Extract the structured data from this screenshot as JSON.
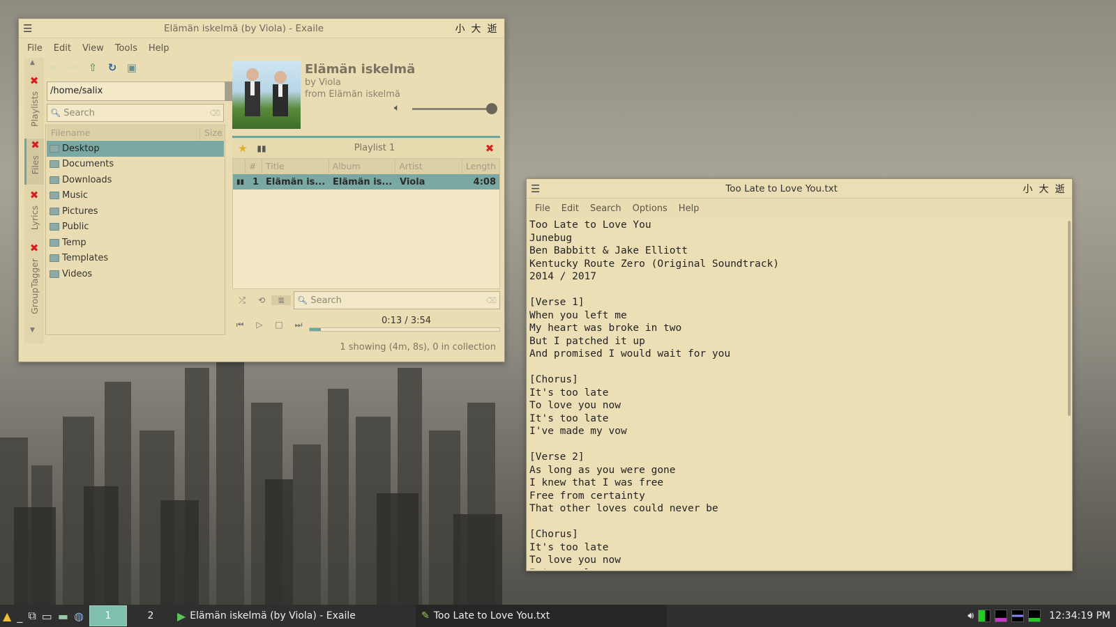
{
  "exaile": {
    "title": "Elämän iskelmä (by Viola) - Exaile",
    "wm_buttons": [
      "小",
      "大",
      "逝"
    ],
    "menu": [
      "File",
      "Edit",
      "View",
      "Tools",
      "Help"
    ],
    "side_tabs": [
      "Playlists",
      "Files",
      "Lyrics",
      "GroupTagger"
    ],
    "path": "/home/salix",
    "search_placeholder": "Search",
    "file_columns": [
      "Filename",
      "Size"
    ],
    "folders": [
      "Desktop",
      "Documents",
      "Downloads",
      "Music",
      "Pictures",
      "Public",
      "Temp",
      "Templates",
      "Videos"
    ],
    "now_playing": {
      "title": "Elämän iskelmä",
      "artist": "by Viola",
      "album": "from Elämän iskelmä",
      "volume_fraction": 0.9
    },
    "playlist_name": "Playlist 1",
    "playlist_columns": [
      "#",
      "Title",
      "Album",
      "Artist",
      "Length"
    ],
    "tracks": [
      {
        "num": "1",
        "title": "Elämän is...",
        "album": "Elämän is...",
        "artist": "Viola",
        "length": "4:08"
      }
    ],
    "playlist_search_placeholder": "Search",
    "time": "0:13 / 3:54",
    "progress_fraction": 0.06,
    "status": "1 showing (4m, 8s), 0 in collection"
  },
  "editor": {
    "title": "Too Late to Love You.txt",
    "wm_buttons": [
      "小",
      "大",
      "逝"
    ],
    "menu": [
      "File",
      "Edit",
      "Search",
      "Options",
      "Help"
    ],
    "text": "Too Late to Love You\nJunebug\nBen Babbitt & Jake Elliott\nKentucky Route Zero (Original Soundtrack)\n2014 / 2017\n\n[Verse 1]\nWhen you left me\nMy heart was broke in two\nBut I patched it up\nAnd promised I would wait for you\n\n[Chorus]\nIt's too late\nTo love you now\nIt's too late\nI've made my vow\n\n[Verse 2]\nAs long as you were gone\nI knew that I was free\nFree from certainty\nThat other loves could never be\n\n[Chorus]\nIt's too late\nTo love you now\nIt's too late"
  },
  "taskbar": {
    "workspaces": [
      "1",
      "2"
    ],
    "tasks": [
      "Elämän iskelmä (by Viola) - Exaile",
      "Too Late to Love You.txt"
    ],
    "clock": "12:34:19 PM"
  },
  "colors": {
    "accent": "#6aa89f",
    "window_bg": "#ebddb3",
    "selection": "#79a9a2",
    "close_red": "#d32020"
  }
}
